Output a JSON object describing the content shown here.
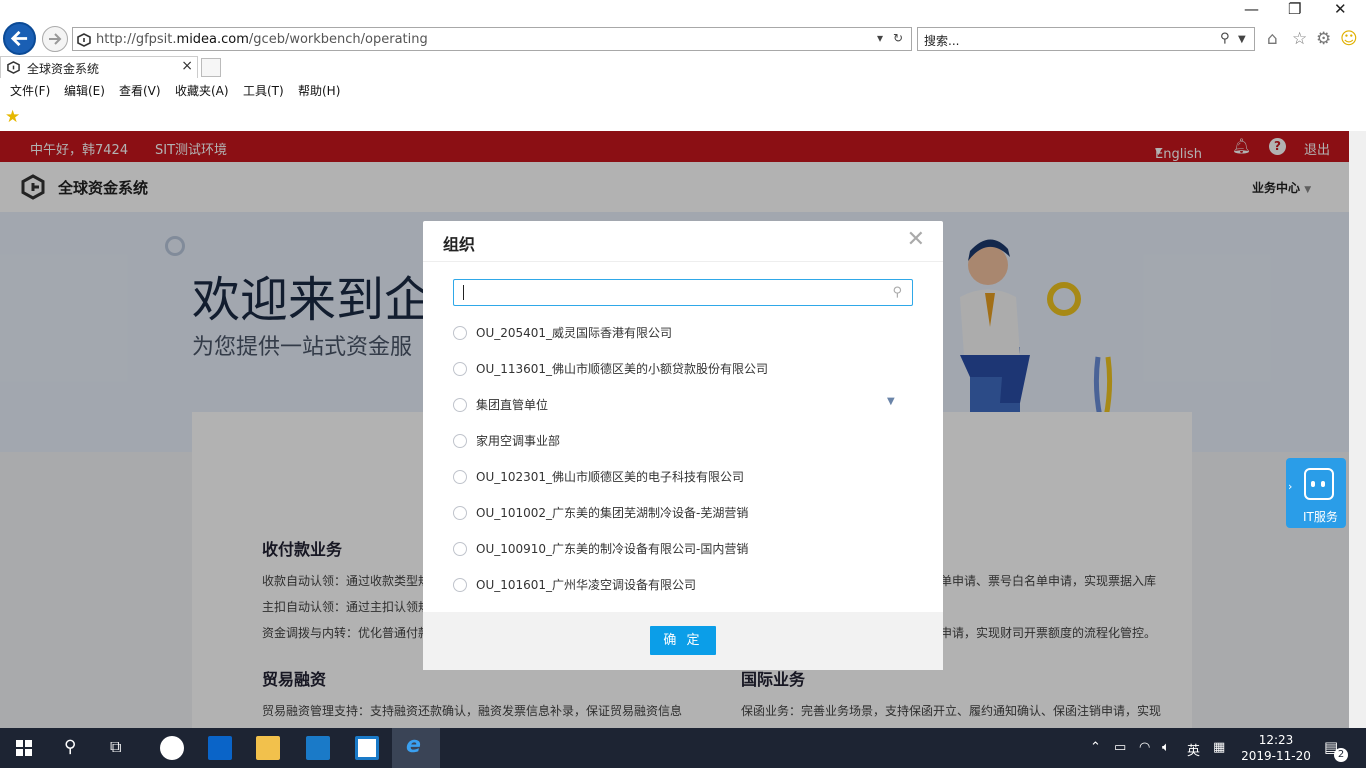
{
  "browser": {
    "url_prefix": "http://gfpsit.",
    "url_domain": "midea.com",
    "url_path": "/gceb/workbench/operating",
    "search_placeholder": "搜索...",
    "tab_title": "全球资金系统",
    "menu": [
      "文件(F)",
      "编辑(E)",
      "查看(V)",
      "收藏夹(A)",
      "工具(T)",
      "帮助(H)"
    ]
  },
  "topbar": {
    "greeting": "中午好，韩7424",
    "env": "SIT测试环境",
    "language": "English",
    "logout": "退出"
  },
  "header": {
    "app_title": "全球资金系统",
    "business_center": "业务中心"
  },
  "banner": {
    "welcome": "欢迎来到企",
    "subtitle": "为您提供一站式资金服"
  },
  "sections": {
    "collect_title": "收付款业务",
    "collect_lines": [
      "收款自动认领：通过收款类型规",
      "主扣自动认领：通过主扣认领规",
      "资金调拨与内转：优化普通付款"
    ],
    "right_lines": [
      "单申请、票号白名单申请，实现票据入库",
      "",
      "申请，实现财司开票额度的流程化管控。"
    ],
    "trade_title": "贸易融资",
    "trade_line": "贸易融资管理支持：支持融资还款确认，融资发票信息补录，保证贸易融资信息",
    "intl_title": "国际业务",
    "intl_line": "保函业务：完善业务场景，支持保函开立、履约通知确认、保函注销申请，实现"
  },
  "modal": {
    "title": "组织",
    "search_value": "",
    "options": [
      {
        "label": "OU_205401_威灵国际香港有限公司",
        "expandable": false
      },
      {
        "label": "OU_113601_佛山市顺德区美的小额贷款股份有限公司",
        "expandable": false
      },
      {
        "label": "集团直管单位",
        "expandable": true
      },
      {
        "label": "家用空调事业部",
        "expandable": false
      },
      {
        "label": "OU_102301_佛山市顺德区美的电子科技有限公司",
        "expandable": false
      },
      {
        "label": "OU_101002_广东美的集团芜湖制冷设备-芜湖营销",
        "expandable": false
      },
      {
        "label": "OU_100910_广东美的制冷设备有限公司-国内营销",
        "expandable": false
      },
      {
        "label": "OU_101601_广州华凌空调设备有限公司",
        "expandable": false
      }
    ],
    "confirm": "确 定"
  },
  "it_service": "IT服务",
  "taskbar": {
    "ime": "英",
    "time": "12:23",
    "date": "2019-11-20",
    "notifications": "2"
  },
  "colors": {
    "brand_red": "#c8161d",
    "accent_blue": "#0b9ee8",
    "taskbar": "#1d2433"
  }
}
